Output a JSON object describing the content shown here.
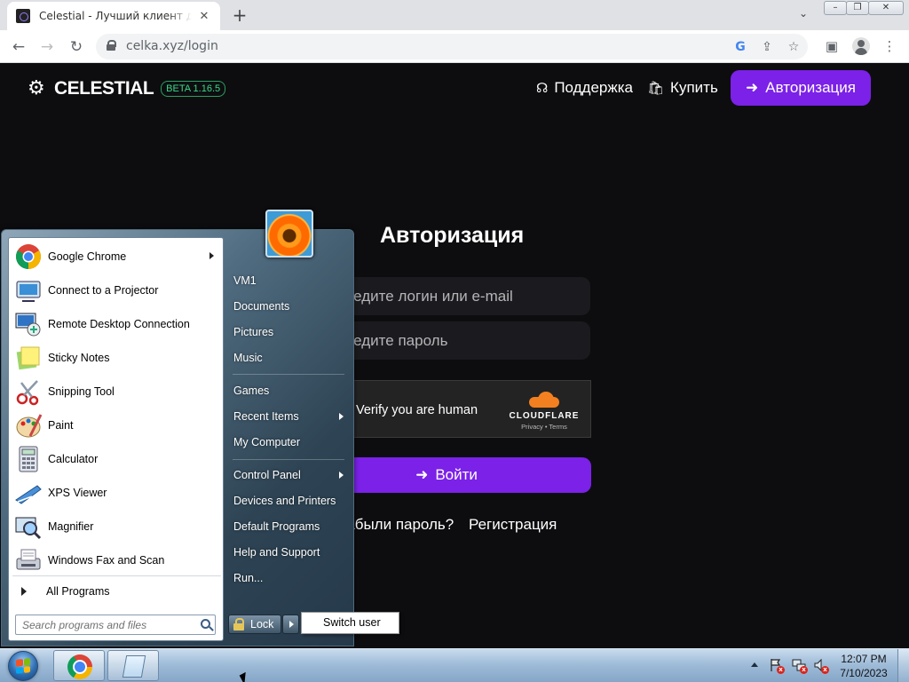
{
  "browser": {
    "tab_title": "Celestial - Лучший клиент для майнкрафт",
    "new_tab_label": "+",
    "url": "celka.xyz/login",
    "window_controls": [
      "–",
      "❐",
      "✕"
    ]
  },
  "site": {
    "brand": "CELESTIAL",
    "beta_badge": "BETA 1.16.5",
    "nav": {
      "support": "Поддержка",
      "buy": "Купить",
      "auth": "Авторизация"
    },
    "login": {
      "title": "Авторизация",
      "login_placeholder": "Введите логин или e-mail",
      "password_placeholder": "Введите пароль",
      "captcha_text": "Verify you are human",
      "captcha_brand": "CLOUDFLARE",
      "captcha_links": "Privacy  •  Terms",
      "submit_label": "Войти",
      "forgot_label": "Забыли пароль?",
      "register_label": "Регистрация"
    },
    "colors": {
      "accent": "#7b21e8",
      "background": "#0d0d0f",
      "beta": "#39d98a"
    }
  },
  "start_menu": {
    "pinned": [
      {
        "label": "Google Chrome",
        "icon": "chrome-icon",
        "has_submenu": true
      },
      {
        "label": "Connect to a Projector",
        "icon": "projector-icon",
        "has_submenu": false
      },
      {
        "label": "Remote Desktop Connection",
        "icon": "remote-desktop-icon",
        "has_submenu": false
      },
      {
        "label": "Sticky Notes",
        "icon": "sticky-notes-icon",
        "has_submenu": false
      },
      {
        "label": "Snipping Tool",
        "icon": "scissors-icon",
        "has_submenu": false
      },
      {
        "label": "Paint",
        "icon": "paint-palette-icon",
        "has_submenu": false
      },
      {
        "label": "Calculator",
        "icon": "calculator-icon",
        "has_submenu": false
      },
      {
        "label": "XPS Viewer",
        "icon": "xps-viewer-icon",
        "has_submenu": false
      },
      {
        "label": "Magnifier",
        "icon": "magnifier-icon",
        "has_submenu": false
      },
      {
        "label": "Windows Fax and Scan",
        "icon": "fax-icon",
        "has_submenu": false
      }
    ],
    "all_programs": "All Programs",
    "search_placeholder": "Search programs and files",
    "right": [
      {
        "label": "VM1",
        "has_submenu": false
      },
      {
        "label": "Documents",
        "has_submenu": false
      },
      {
        "label": "Pictures",
        "has_submenu": false
      },
      {
        "label": "Music",
        "has_submenu": false
      },
      {
        "label": "Games",
        "has_submenu": false
      },
      {
        "label": "Recent Items",
        "has_submenu": true
      },
      {
        "label": "My Computer",
        "has_submenu": false
      },
      {
        "label": "Control Panel",
        "has_submenu": true
      },
      {
        "label": "Devices and Printers",
        "has_submenu": false
      },
      {
        "label": "Default Programs",
        "has_submenu": false
      },
      {
        "label": "Help and Support",
        "has_submenu": false
      },
      {
        "label": "Run...",
        "has_submenu": false
      }
    ],
    "lock_label": "Lock",
    "switch_user_label": "Switch user"
  },
  "taskbar": {
    "time": "12:07 PM",
    "date": "7/10/2023",
    "pinned": [
      "chrome-icon",
      "notepad-icon"
    ]
  }
}
